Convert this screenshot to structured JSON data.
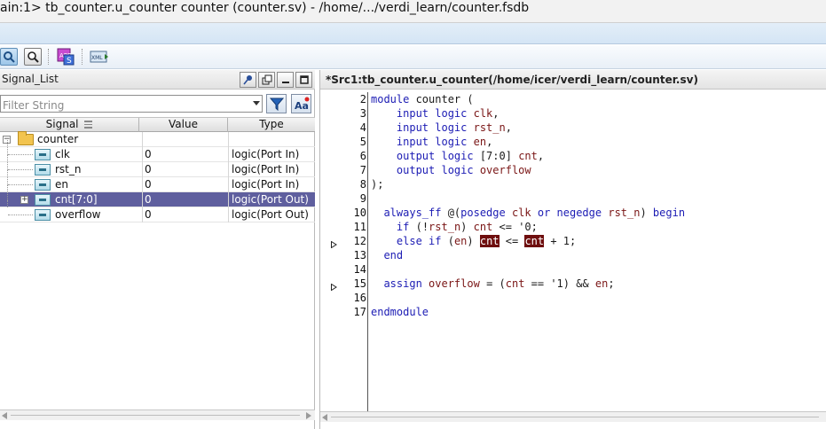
{
  "window": {
    "title": "ain:1> tb_counter.u_counter counter (counter.sv) - /home/.../verdi_learn/counter.fsdb"
  },
  "toolbar": {
    "icons": [
      "zoom-search-icon",
      "find-icon",
      "app-s-icon",
      "xml-icon"
    ]
  },
  "signal_list": {
    "title": "Signal_List",
    "filter_placeholder": "Filter String",
    "columns": {
      "signal": "Signal",
      "value": "Value",
      "type": "Type"
    },
    "root": "counter",
    "rows": [
      {
        "name": "clk",
        "value": "0",
        "type": "logic(Port In)",
        "selected": false
      },
      {
        "name": "rst_n",
        "value": "0",
        "type": "logic(Port In)",
        "selected": false
      },
      {
        "name": "en",
        "value": "0",
        "type": "logic(Port In)",
        "selected": false
      },
      {
        "name": "cnt[7:0]",
        "value": "0",
        "type": "logic(Port Out)",
        "selected": true
      },
      {
        "name": "overflow",
        "value": "0",
        "type": "logic(Port Out)",
        "selected": false
      }
    ]
  },
  "source": {
    "tab_title": "*Src1:tb_counter.u_counter(/home/icer/verdi_learn/counter.sv)",
    "lines": [
      {
        "num": "2",
        "segs": [
          [
            "kw",
            "module "
          ],
          [
            "plain",
            "counter ("
          ]
        ]
      },
      {
        "num": "3",
        "segs": [
          [
            "plain",
            "    "
          ],
          [
            "kw",
            "input logic "
          ],
          [
            "id",
            "clk"
          ],
          [
            "plain",
            ","
          ]
        ]
      },
      {
        "num": "4",
        "segs": [
          [
            "plain",
            "    "
          ],
          [
            "kw",
            "input logic "
          ],
          [
            "id",
            "rst_n"
          ],
          [
            "plain",
            ","
          ]
        ]
      },
      {
        "num": "5",
        "segs": [
          [
            "plain",
            "    "
          ],
          [
            "kw",
            "input logic "
          ],
          [
            "id",
            "en"
          ],
          [
            "plain",
            ","
          ]
        ]
      },
      {
        "num": "6",
        "segs": [
          [
            "plain",
            "    "
          ],
          [
            "kw",
            "output logic "
          ],
          [
            "plain",
            "[7:0] "
          ],
          [
            "id",
            "cnt"
          ],
          [
            "plain",
            ","
          ]
        ]
      },
      {
        "num": "7",
        "segs": [
          [
            "plain",
            "    "
          ],
          [
            "kw",
            "output logic "
          ],
          [
            "id",
            "overflow"
          ]
        ]
      },
      {
        "num": "8",
        "segs": [
          [
            "plain",
            ");"
          ]
        ]
      },
      {
        "num": "9",
        "segs": []
      },
      {
        "num": "10",
        "segs": [
          [
            "plain",
            "  "
          ],
          [
            "kw",
            "always_ff "
          ],
          [
            "plain",
            "@("
          ],
          [
            "kw",
            "posedge "
          ],
          [
            "id",
            "clk "
          ],
          [
            "kw",
            "or negedge "
          ],
          [
            "id",
            "rst_n"
          ],
          [
            "plain",
            ") "
          ],
          [
            "kw",
            "begin"
          ]
        ]
      },
      {
        "num": "11",
        "segs": [
          [
            "plain",
            "    "
          ],
          [
            "kw",
            "if "
          ],
          [
            "plain",
            "(!"
          ],
          [
            "id",
            "rst_n"
          ],
          [
            "plain",
            ") "
          ],
          [
            "id",
            "cnt "
          ],
          [
            "plain",
            "<= '0;"
          ]
        ]
      },
      {
        "num": "12",
        "mark": true,
        "segs": [
          [
            "plain",
            "    "
          ],
          [
            "kw",
            "else if "
          ],
          [
            "plain",
            "("
          ],
          [
            "id",
            "en"
          ],
          [
            "plain",
            ") "
          ],
          [
            "hl",
            "cnt"
          ],
          [
            "plain",
            " <= "
          ],
          [
            "hl",
            "cnt"
          ],
          [
            "plain",
            " + 1;"
          ]
        ]
      },
      {
        "num": "13",
        "segs": [
          [
            "plain",
            "  "
          ],
          [
            "kw",
            "end"
          ]
        ]
      },
      {
        "num": "14",
        "segs": []
      },
      {
        "num": "15",
        "mark": true,
        "segs": [
          [
            "plain",
            "  "
          ],
          [
            "kw",
            "assign "
          ],
          [
            "id",
            "overflow "
          ],
          [
            "plain",
            "= ("
          ],
          [
            "id",
            "cnt "
          ],
          [
            "plain",
            "== '1) && "
          ],
          [
            "id",
            "en"
          ],
          [
            "plain",
            ";"
          ]
        ]
      },
      {
        "num": "16",
        "segs": []
      },
      {
        "num": "17",
        "segs": [
          [
            "kw",
            "endmodule"
          ]
        ]
      }
    ]
  },
  "colors": {
    "selection": "#5f5f9e",
    "keyword": "#1c1cb4",
    "identifier": "#7a1616",
    "highlight": "#6e0e0e"
  }
}
